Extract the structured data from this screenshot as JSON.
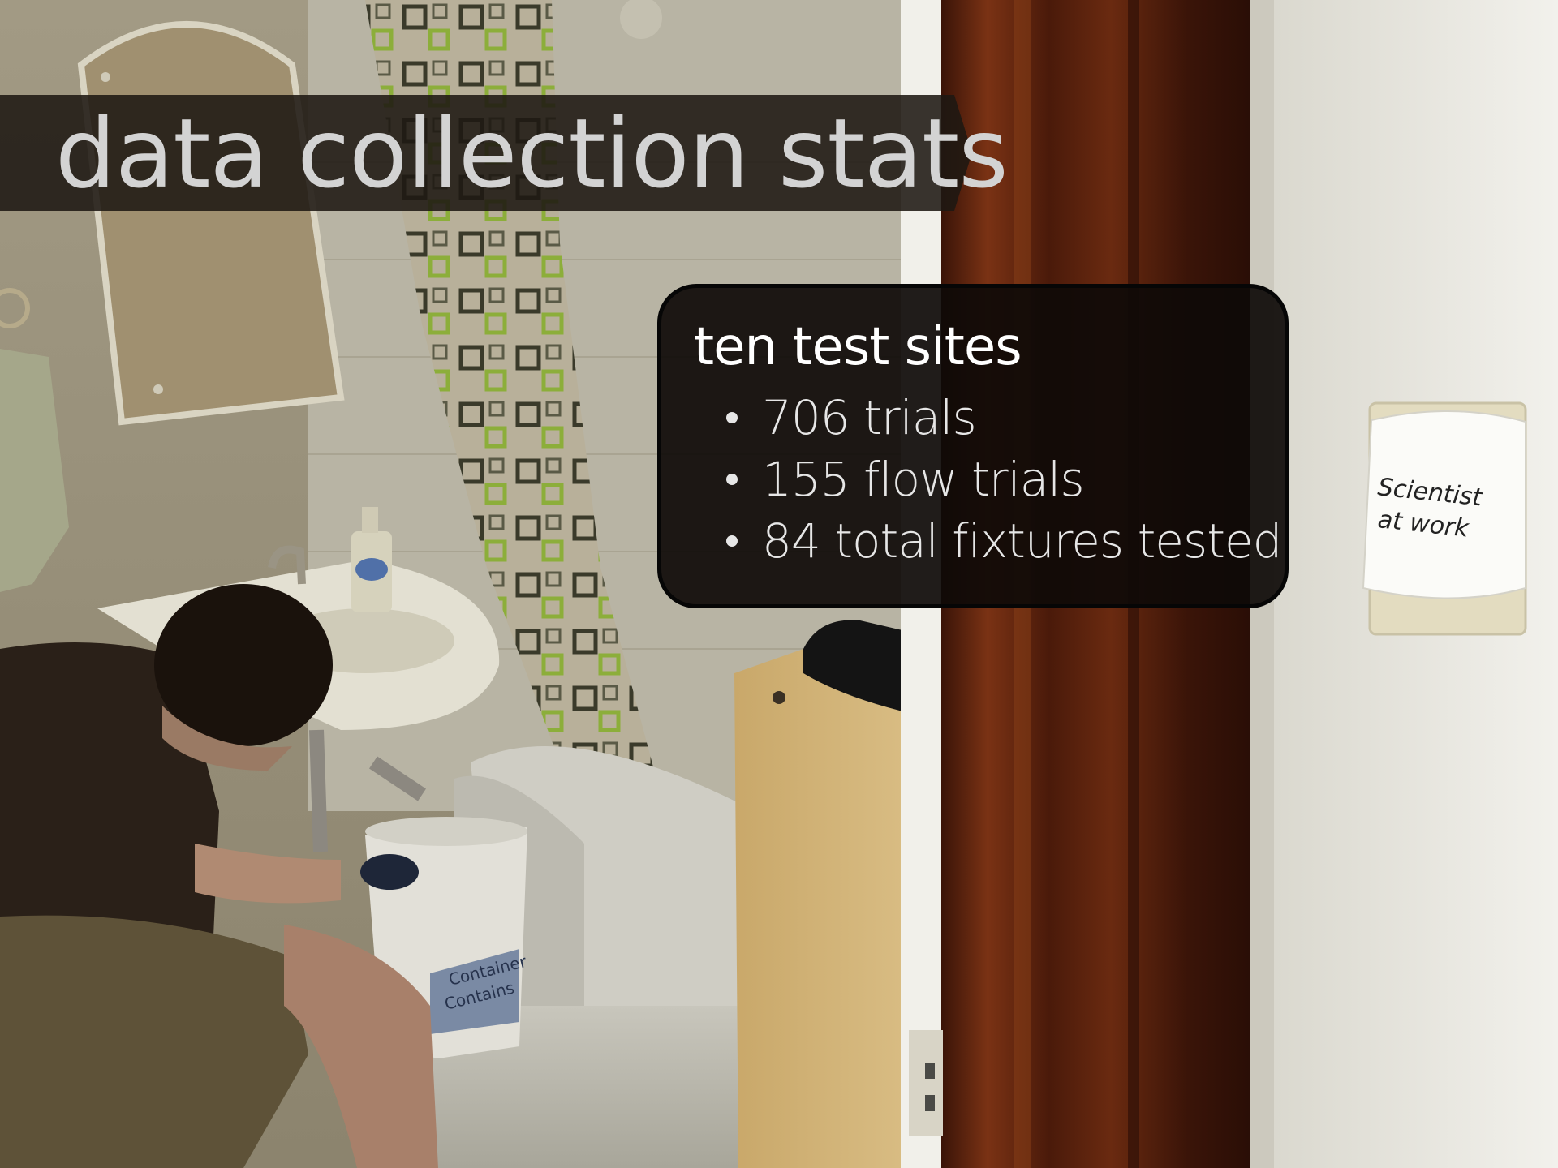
{
  "slide": {
    "title": "data collection stats",
    "callout": {
      "heading": "ten test sites",
      "bullets": [
        "706 trials",
        "155 flow trials",
        "84 total fixtures tested"
      ]
    },
    "photo": {
      "sign_text": [
        "Scientist",
        "at work"
      ],
      "bucket_text": [
        "Container",
        "Contains"
      ]
    }
  },
  "colors": {
    "banner": "#1e1812",
    "title_text": "#d3d3d3",
    "callout_bg": "#0e0a08",
    "callout_text": "#ffffff",
    "door_frame": "#5a2410",
    "wall": "#e8e6de"
  }
}
